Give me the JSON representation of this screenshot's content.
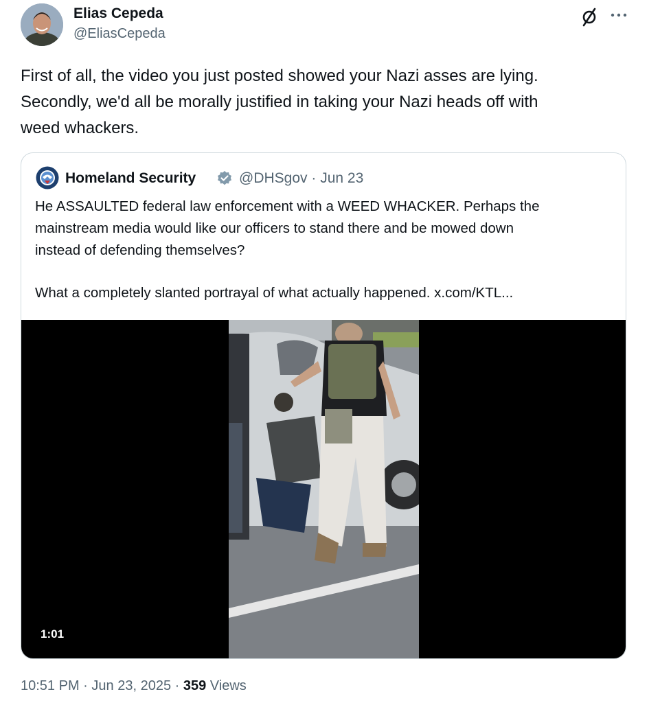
{
  "author": {
    "name": "Elias Cepeda",
    "handle": "@EliasCepeda"
  },
  "post": {
    "lines": [
      "First of all, the video you just posted showed your Nazi asses are lying.",
      "Secondly, we'd all be morally justified in taking your Nazi heads off with",
      "weed whackers."
    ],
    "time": "10:51 PM",
    "date": "Jun 23, 2025",
    "separator": "·",
    "views_count": "359",
    "views_label": "Views"
  },
  "quoted": {
    "name": "Homeland Security",
    "handle": "@DHSgov",
    "separator": "·",
    "date": "Jun 23",
    "lines": [
      "He ASSAULTED federal law enforcement with a WEED WHACKER. Perhaps the",
      "mainstream media would like our officers to stand there and be mowed down",
      "instead of defending themselves?"
    ],
    "line2": "What a completely slanted portrayal of what actually happened.  x.com/KTL...",
    "video_duration": "1:01"
  },
  "icons": {
    "grok": "grok-icon",
    "more": "more-icon",
    "verified": "verified-badge-icon"
  },
  "colors": {
    "text_primary": "#0f1419",
    "text_secondary": "#536471",
    "border": "#cfd9de",
    "verified_badge": "#829aab"
  }
}
